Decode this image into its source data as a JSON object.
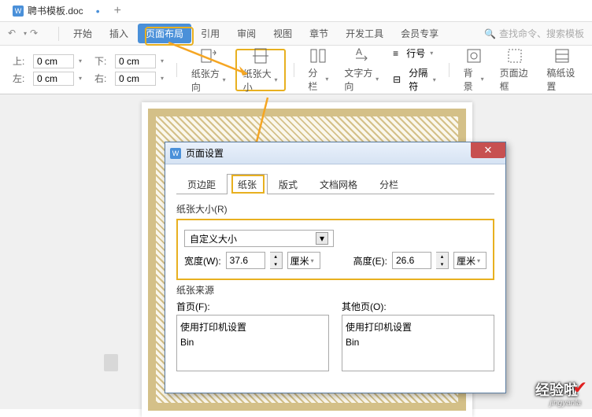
{
  "doc": {
    "title": "聘书模板.doc",
    "icon": "W"
  },
  "menu": {
    "items": [
      "开始",
      "插入",
      "页面布局",
      "引用",
      "审阅",
      "视图",
      "章节",
      "开发工具",
      "会员专享"
    ],
    "search": "查找命令、搜索模板"
  },
  "ribbon": {
    "margins": {
      "top_lbl": "上:",
      "top": "0 cm",
      "bottom_lbl": "下:",
      "bottom": "0 cm",
      "left_lbl": "左:",
      "left": "0 cm",
      "right_lbl": "右:",
      "right": "0 cm"
    },
    "orientation": "纸张方向",
    "size": "纸张大小",
    "columns": "分栏",
    "textdir": "文字方向",
    "linenum": "行号",
    "sepchar": "分隔符",
    "bg": "背景",
    "border": "页面边框",
    "grid": "稿纸设置"
  },
  "dialog": {
    "title": "页面设置",
    "tabs": [
      "页边距",
      "纸张",
      "版式",
      "文档网格",
      "分栏"
    ],
    "size_lbl": "纸张大小(R)",
    "preset": "自定义大小",
    "w_lbl": "宽度(W):",
    "w": "37.6",
    "h_lbl": "高度(E):",
    "h": "26.6",
    "unit": "厘米",
    "source_lbl": "纸张来源",
    "first_lbl": "首页(F):",
    "other_lbl": "其他页(O):",
    "list1": [
      "使用打印机设置",
      "Bin"
    ],
    "list2": [
      "使用打印机设置",
      "Bin"
    ]
  },
  "wm": {
    "main": "经验啦",
    "sub": "jingyanla"
  }
}
